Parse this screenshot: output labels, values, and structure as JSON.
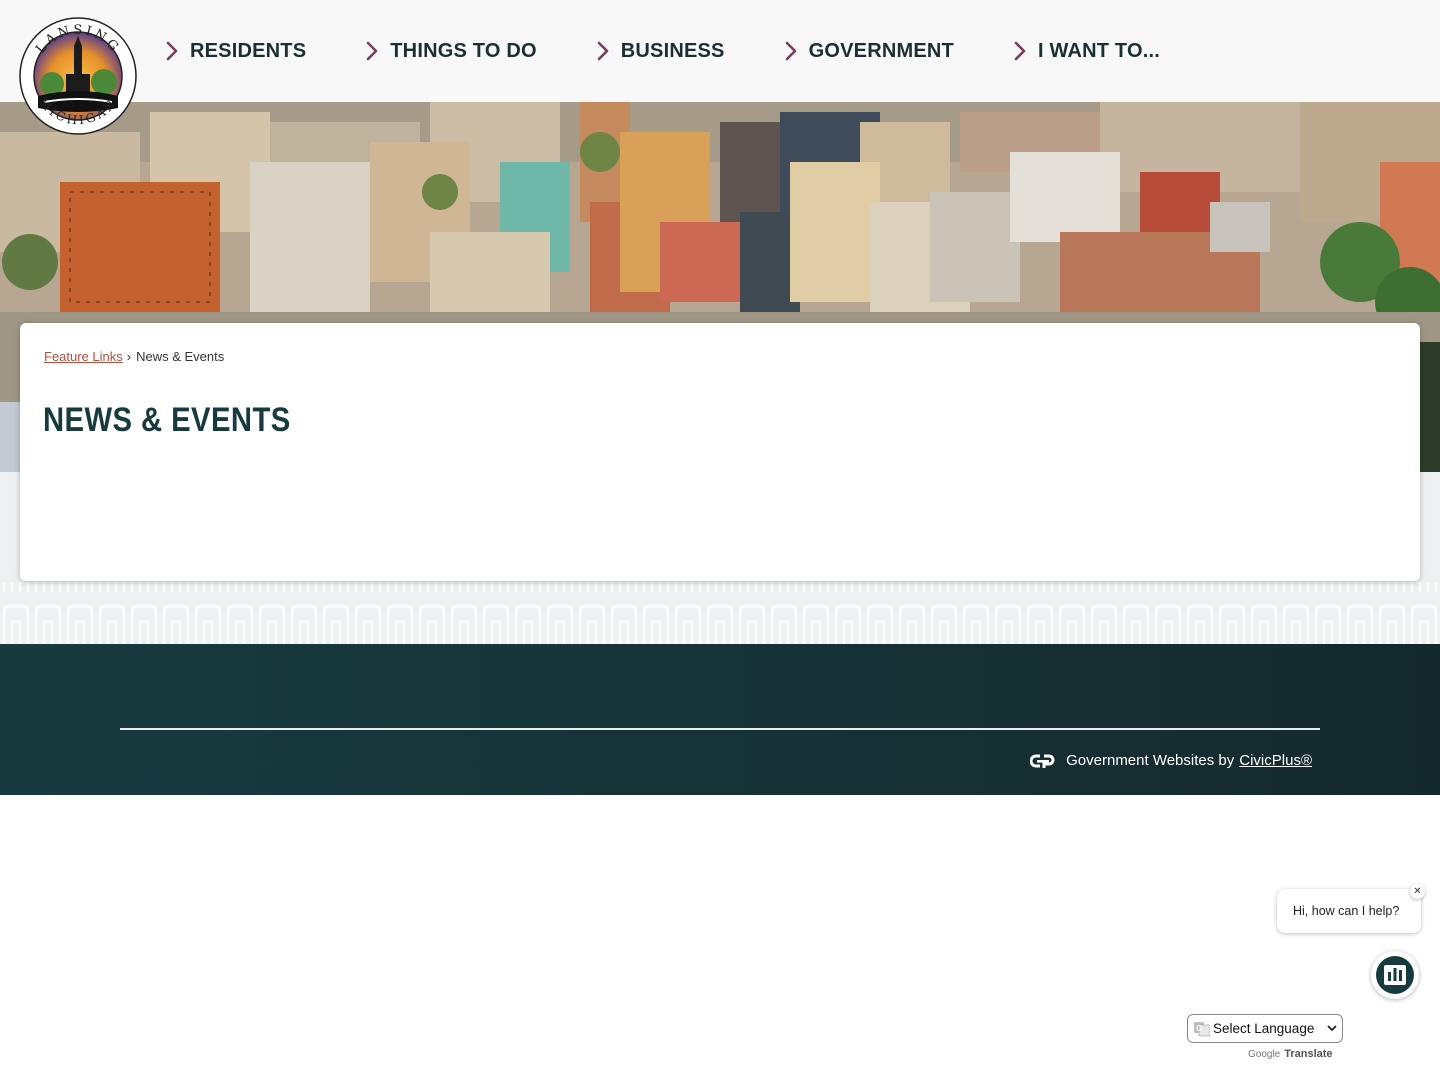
{
  "header": {
    "logo": {
      "top_text": "LANSING",
      "bottom_text": "MICHIGAN",
      "icon": "city-seal-logo"
    },
    "nav": [
      {
        "label": "RESIDENTS",
        "icon": "chevron-right-icon"
      },
      {
        "label": "THINGS TO DO",
        "icon": "chevron-right-icon"
      },
      {
        "label": "BUSINESS",
        "icon": "chevron-right-icon"
      },
      {
        "label": "GOVERNMENT",
        "icon": "chevron-right-icon"
      },
      {
        "label": "I WANT TO...",
        "icon": "chevron-right-icon"
      }
    ]
  },
  "breadcrumb": {
    "parent": "Feature Links",
    "separator": "›",
    "current": "News & Events"
  },
  "page_title": "NEWS & EVENTS",
  "footer": {
    "credit_text": "Government Websites by",
    "credit_link": "CivicPlus®",
    "icon": "civicplus-icon"
  },
  "chat": {
    "greeting": "Hi, how can I help?",
    "close": "✕",
    "launcher_icon": "chat-bot-icon"
  },
  "translate": {
    "select_label": "Select Language",
    "powered_by": "Google",
    "translate_label": "Translate"
  },
  "colors": {
    "nav_text": "#1b2f33",
    "chevron": "#7a3b5c",
    "title": "#173a3e",
    "breadcrumb_link": "#b5503c",
    "footer_bg": "#163337"
  }
}
